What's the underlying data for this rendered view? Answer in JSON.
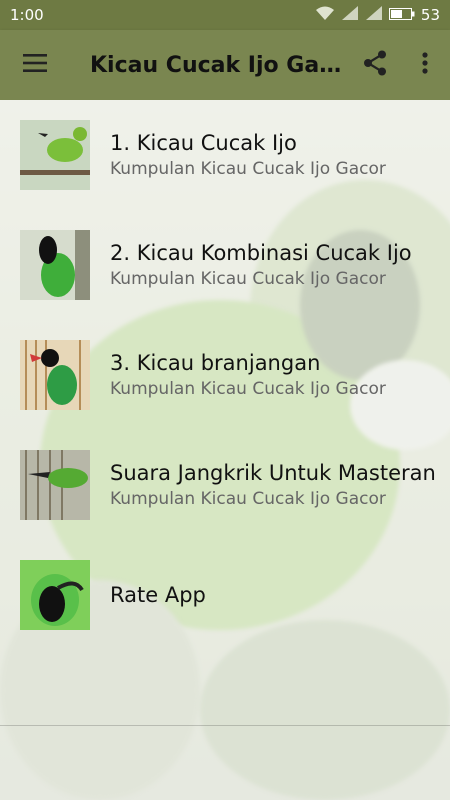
{
  "status_bar": {
    "time": "1:00",
    "battery": "53"
  },
  "app_bar": {
    "title": "Kicau Cucak Ijo Gacor",
    "menu_icon": "hamburger-menu-icon",
    "share_icon": "share-icon",
    "overflow_icon": "more-vert-icon"
  },
  "list": [
    {
      "title": "1. Kicau Cucak Ijo",
      "subtitle": "Kumpulan Kicau Cucak Ijo Gacor",
      "thumb": "bird-thumbnail-1"
    },
    {
      "title": "2. Kicau Kombinasi Cucak Ijo",
      "subtitle": "Kumpulan Kicau Cucak Ijo Gacor",
      "thumb": "bird-thumbnail-2"
    },
    {
      "title": "3. Kicau branjangan",
      "subtitle": "Kumpulan Kicau Cucak Ijo Gacor",
      "thumb": "bird-thumbnail-3"
    },
    {
      "title": "Suara Jangkrik Untuk Masteran",
      "subtitle": "Kumpulan Kicau Cucak Ijo Gacor",
      "thumb": "bird-thumbnail-4"
    },
    {
      "title": "Rate App",
      "subtitle": "",
      "thumb": "bird-thumbnail-5"
    }
  ],
  "colors": {
    "status_bar": "#6e7a43",
    "app_bar": "#7a8650",
    "title_text": "#111111",
    "subtitle_text": "#666666"
  }
}
